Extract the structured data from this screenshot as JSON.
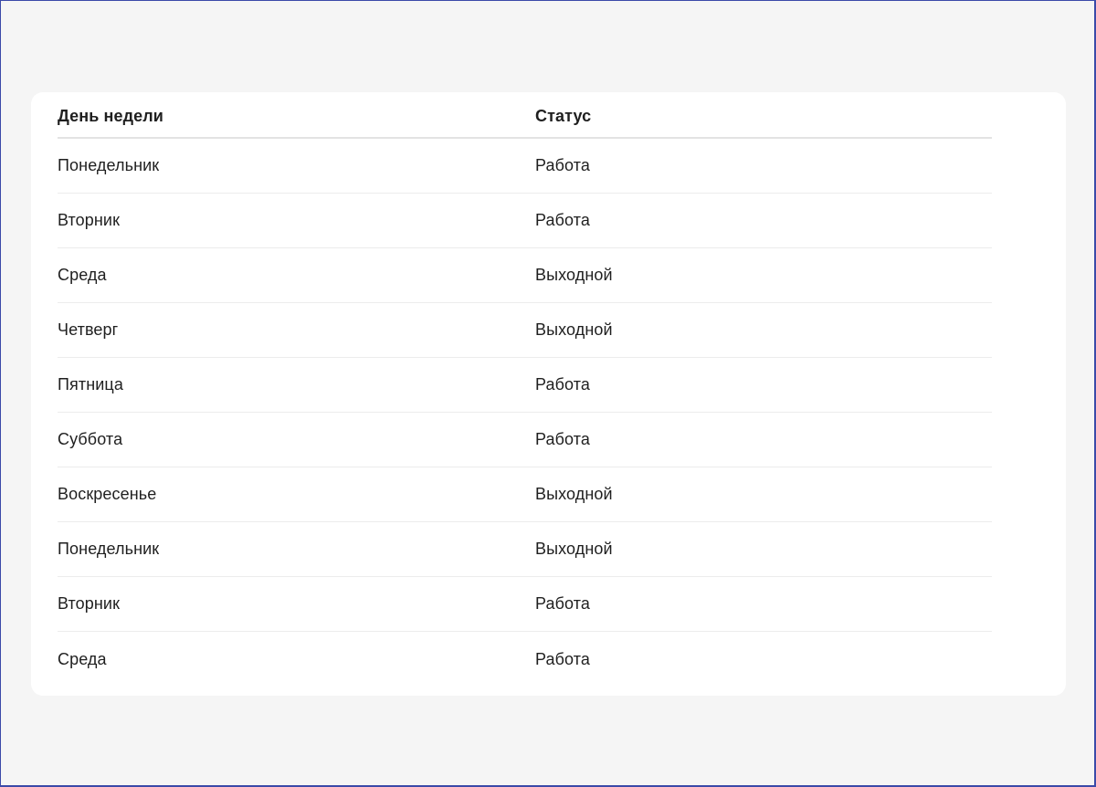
{
  "table": {
    "headers": [
      "День недели",
      "Статус"
    ],
    "rows": [
      {
        "day": "Понедельник",
        "status": "Работа"
      },
      {
        "day": "Вторник",
        "status": "Работа"
      },
      {
        "day": "Среда",
        "status": "Выходной"
      },
      {
        "day": "Четверг",
        "status": "Выходной"
      },
      {
        "day": "Пятница",
        "status": "Работа"
      },
      {
        "day": "Суббота",
        "status": "Работа"
      },
      {
        "day": "Воскресенье",
        "status": "Выходной"
      },
      {
        "day": "Понедельник",
        "status": "Выходной"
      },
      {
        "day": "Вторник",
        "status": "Работа"
      },
      {
        "day": "Среда",
        "status": "Работа"
      }
    ]
  }
}
